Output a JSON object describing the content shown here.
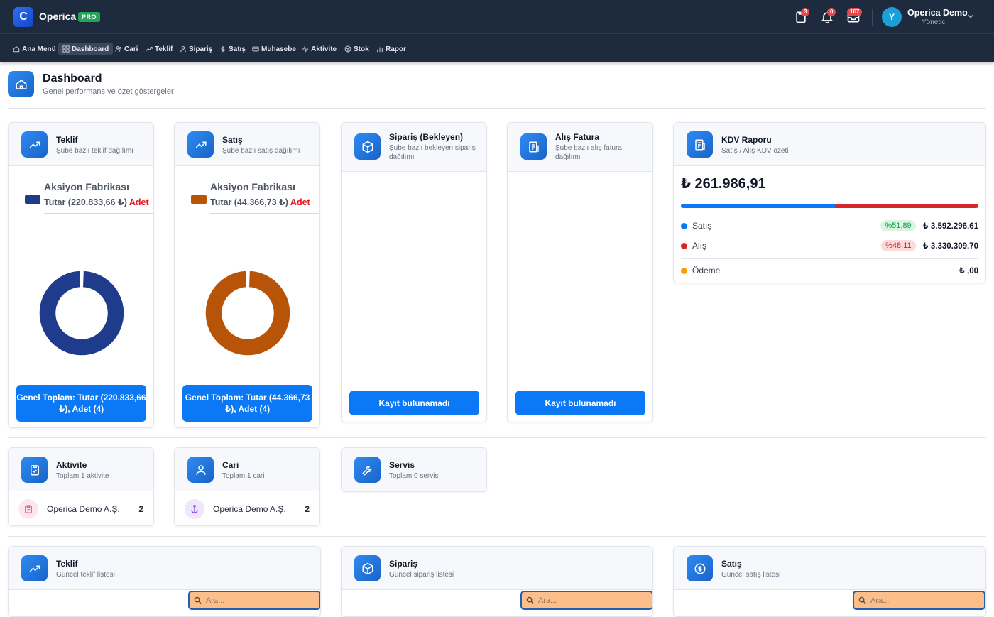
{
  "topbar": {
    "logo_letter": "C",
    "brand": "Operica",
    "pro": "PRO",
    "badges": {
      "tasks": "3",
      "notifications": "0",
      "messages": "167"
    },
    "user_initial": "Y",
    "user_name": "Operica Demo",
    "user_role": "Yönetici"
  },
  "nav": {
    "items": [
      "Ana Menü",
      "Dashboard",
      "Cari",
      "Teklif",
      "Sipariş",
      "Satış",
      "Muhasebe",
      "Aktivite",
      "Stok",
      "Rapor"
    ],
    "active": "Dashboard"
  },
  "page": {
    "title": "Dashboard",
    "subtitle": "Genel performans ve özet göstergeler"
  },
  "cards": {
    "teklif": {
      "title": "Teklif",
      "subtitle": "Şube bazlı teklif dağılımı",
      "legend_title": "Aksiyon Fabrikası",
      "legend_value": "Tutar (220.833,66 ₺)",
      "legend_adet": "Adet",
      "button": "Genel Toplam: Tutar (220.833,66 ₺), Adet (4)"
    },
    "satis": {
      "title": "Satış",
      "subtitle": "Şube bazlı satış dağılımı",
      "legend_title": "Aksiyon Fabrikası",
      "legend_value": "Tutar (44.366,73 ₺)",
      "legend_adet": "Adet",
      "button": "Genel Toplam: Tutar (44.366,73 ₺), Adet (4)"
    },
    "siparis": {
      "title": "Sipariş (Bekleyen)",
      "subtitle": "Şube bazlı bekleyen sipariş dağılımı",
      "button": "Kayıt bulunamadı"
    },
    "alis": {
      "title": "Alış Fatura",
      "subtitle": "Şube bazlı alış fatura dağılımı",
      "button": "Kayıt bulunamadı"
    },
    "kdv": {
      "title": "KDV Raporu",
      "subtitle": "Satış / Alış KDV özeti",
      "amount": "₺ 261.986,91",
      "rows": [
        {
          "label": "Satış",
          "pct": "%51,89",
          "value": "₺ 3.592.296,61"
        },
        {
          "label": "Alış",
          "pct": "%48,11",
          "value": "₺ 3.330.309,70"
        },
        {
          "label": "Ödeme",
          "value": "₺ ,00"
        }
      ],
      "satis_share": 51.89
    },
    "aktivite": {
      "title": "Aktivite",
      "subtitle": "Toplam 1 aktivite",
      "row_name": "Operica Demo A.Ş.",
      "row_count": "2"
    },
    "cari": {
      "title": "Cari",
      "subtitle": "Toplam 1 cari",
      "row_name": "Operica Demo A.Ş.",
      "row_count": "2"
    },
    "servis": {
      "title": "Servis",
      "subtitle": "Toplam 0 servis"
    },
    "teklif_list": {
      "title": "Teklif",
      "subtitle": "Güncel teklif listesi",
      "search_placeholder": "Ara..."
    },
    "siparis_list": {
      "title": "Sipariş",
      "subtitle": "Güncel sipariş listesi",
      "search_placeholder": "Ara..."
    },
    "satis_list": {
      "title": "Satış",
      "subtitle": "Güncel satış listesi",
      "search_placeholder": "Ara..."
    }
  },
  "colors": {
    "teklif_donut": "#1f3c8c",
    "satis_donut": "#b85408",
    "kdv_satis": "#0b78f5",
    "kdv_alis": "#d62828",
    "kdv_odeme": "#f59e0b",
    "primary_button": "#0b78f5"
  },
  "chart_data": [
    {
      "type": "pie",
      "categories": [
        "Aksiyon Fabrikası"
      ],
      "values": [
        220833.66
      ]
    },
    {
      "type": "pie",
      "categories": [
        "Aksiyon Fabrikası"
      ],
      "values": [
        44366.73
      ]
    }
  ]
}
